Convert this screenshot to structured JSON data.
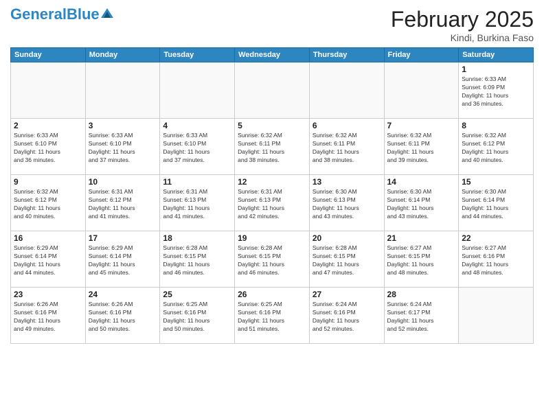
{
  "header": {
    "logo_text1": "General",
    "logo_text2": "Blue",
    "month": "February 2025",
    "location": "Kindi, Burkina Faso"
  },
  "weekdays": [
    "Sunday",
    "Monday",
    "Tuesday",
    "Wednesday",
    "Thursday",
    "Friday",
    "Saturday"
  ],
  "weeks": [
    [
      {
        "day": "",
        "info": ""
      },
      {
        "day": "",
        "info": ""
      },
      {
        "day": "",
        "info": ""
      },
      {
        "day": "",
        "info": ""
      },
      {
        "day": "",
        "info": ""
      },
      {
        "day": "",
        "info": ""
      },
      {
        "day": "1",
        "info": "Sunrise: 6:33 AM\nSunset: 6:09 PM\nDaylight: 11 hours\nand 36 minutes."
      }
    ],
    [
      {
        "day": "2",
        "info": "Sunrise: 6:33 AM\nSunset: 6:10 PM\nDaylight: 11 hours\nand 36 minutes."
      },
      {
        "day": "3",
        "info": "Sunrise: 6:33 AM\nSunset: 6:10 PM\nDaylight: 11 hours\nand 37 minutes."
      },
      {
        "day": "4",
        "info": "Sunrise: 6:33 AM\nSunset: 6:10 PM\nDaylight: 11 hours\nand 37 minutes."
      },
      {
        "day": "5",
        "info": "Sunrise: 6:32 AM\nSunset: 6:11 PM\nDaylight: 11 hours\nand 38 minutes."
      },
      {
        "day": "6",
        "info": "Sunrise: 6:32 AM\nSunset: 6:11 PM\nDaylight: 11 hours\nand 38 minutes."
      },
      {
        "day": "7",
        "info": "Sunrise: 6:32 AM\nSunset: 6:11 PM\nDaylight: 11 hours\nand 39 minutes."
      },
      {
        "day": "8",
        "info": "Sunrise: 6:32 AM\nSunset: 6:12 PM\nDaylight: 11 hours\nand 40 minutes."
      }
    ],
    [
      {
        "day": "9",
        "info": "Sunrise: 6:32 AM\nSunset: 6:12 PM\nDaylight: 11 hours\nand 40 minutes."
      },
      {
        "day": "10",
        "info": "Sunrise: 6:31 AM\nSunset: 6:12 PM\nDaylight: 11 hours\nand 41 minutes."
      },
      {
        "day": "11",
        "info": "Sunrise: 6:31 AM\nSunset: 6:13 PM\nDaylight: 11 hours\nand 41 minutes."
      },
      {
        "day": "12",
        "info": "Sunrise: 6:31 AM\nSunset: 6:13 PM\nDaylight: 11 hours\nand 42 minutes."
      },
      {
        "day": "13",
        "info": "Sunrise: 6:30 AM\nSunset: 6:13 PM\nDaylight: 11 hours\nand 43 minutes."
      },
      {
        "day": "14",
        "info": "Sunrise: 6:30 AM\nSunset: 6:14 PM\nDaylight: 11 hours\nand 43 minutes."
      },
      {
        "day": "15",
        "info": "Sunrise: 6:30 AM\nSunset: 6:14 PM\nDaylight: 11 hours\nand 44 minutes."
      }
    ],
    [
      {
        "day": "16",
        "info": "Sunrise: 6:29 AM\nSunset: 6:14 PM\nDaylight: 11 hours\nand 44 minutes."
      },
      {
        "day": "17",
        "info": "Sunrise: 6:29 AM\nSunset: 6:14 PM\nDaylight: 11 hours\nand 45 minutes."
      },
      {
        "day": "18",
        "info": "Sunrise: 6:28 AM\nSunset: 6:15 PM\nDaylight: 11 hours\nand 46 minutes."
      },
      {
        "day": "19",
        "info": "Sunrise: 6:28 AM\nSunset: 6:15 PM\nDaylight: 11 hours\nand 46 minutes."
      },
      {
        "day": "20",
        "info": "Sunrise: 6:28 AM\nSunset: 6:15 PM\nDaylight: 11 hours\nand 47 minutes."
      },
      {
        "day": "21",
        "info": "Sunrise: 6:27 AM\nSunset: 6:15 PM\nDaylight: 11 hours\nand 48 minutes."
      },
      {
        "day": "22",
        "info": "Sunrise: 6:27 AM\nSunset: 6:16 PM\nDaylight: 11 hours\nand 48 minutes."
      }
    ],
    [
      {
        "day": "23",
        "info": "Sunrise: 6:26 AM\nSunset: 6:16 PM\nDaylight: 11 hours\nand 49 minutes."
      },
      {
        "day": "24",
        "info": "Sunrise: 6:26 AM\nSunset: 6:16 PM\nDaylight: 11 hours\nand 50 minutes."
      },
      {
        "day": "25",
        "info": "Sunrise: 6:25 AM\nSunset: 6:16 PM\nDaylight: 11 hours\nand 50 minutes."
      },
      {
        "day": "26",
        "info": "Sunrise: 6:25 AM\nSunset: 6:16 PM\nDaylight: 11 hours\nand 51 minutes."
      },
      {
        "day": "27",
        "info": "Sunrise: 6:24 AM\nSunset: 6:16 PM\nDaylight: 11 hours\nand 52 minutes."
      },
      {
        "day": "28",
        "info": "Sunrise: 6:24 AM\nSunset: 6:17 PM\nDaylight: 11 hours\nand 52 minutes."
      },
      {
        "day": "",
        "info": ""
      }
    ]
  ]
}
